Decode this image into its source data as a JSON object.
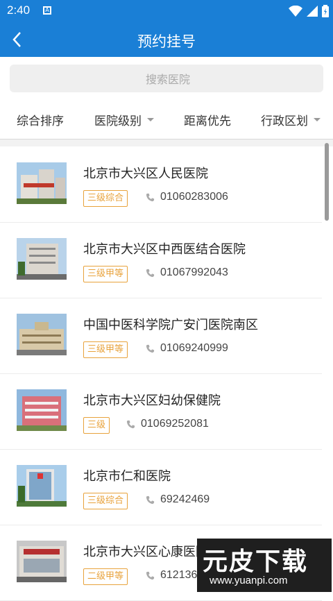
{
  "status": {
    "time": "2:40",
    "notif_label": "A"
  },
  "appbar": {
    "title": "预约挂号"
  },
  "search": {
    "placeholder": "搜索医院"
  },
  "filters": [
    {
      "label": "综合排序",
      "dropdown": false
    },
    {
      "label": "医院级别",
      "dropdown": true
    },
    {
      "label": "距离优先",
      "dropdown": false
    },
    {
      "label": "行政区划",
      "dropdown": true
    }
  ],
  "hospitals": [
    {
      "name": "北京市大兴区人民医院",
      "level": "三级综合",
      "phone": "01060283006"
    },
    {
      "name": "北京市大兴区中西医结合医院",
      "level": "三级甲等",
      "phone": "01067992043"
    },
    {
      "name": "中国中医科学院广安门医院南区",
      "level": "三级甲等",
      "phone": "01069240999"
    },
    {
      "name": "北京市大兴区妇幼保健院",
      "level": "三级",
      "phone": "01069252081"
    },
    {
      "name": "北京市仁和医院",
      "level": "三级综合",
      "phone": "69242469"
    },
    {
      "name": "北京市大兴区心康医院",
      "level": "二级甲等",
      "phone": "6121367"
    }
  ],
  "watermark": {
    "brand": "元皮下载",
    "url": "www.yuanpi.com"
  },
  "colors": {
    "primary": "#1a7fd6",
    "badge": "#e8a23b"
  }
}
